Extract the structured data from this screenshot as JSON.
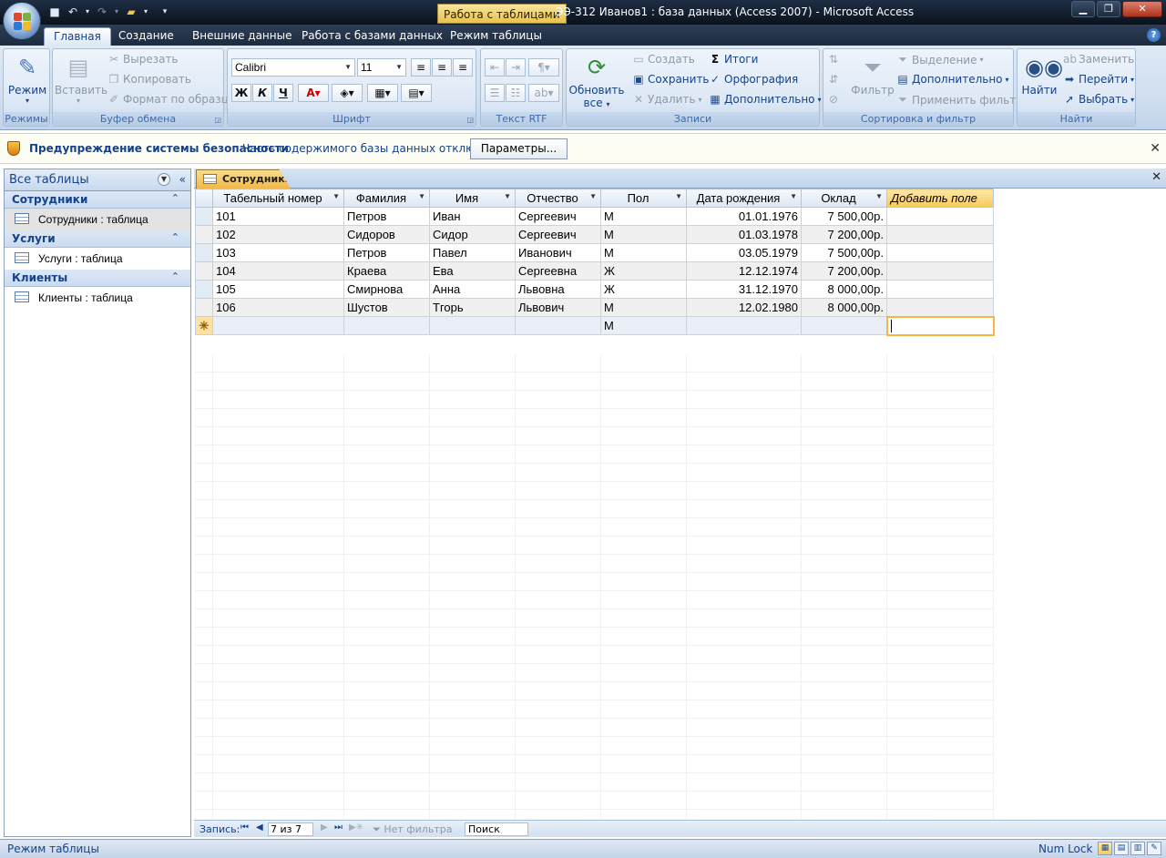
{
  "title_bar": {
    "context_tab": "Работа с таблицами",
    "title": "ЭЭ-312 Иванов1 : база данных (Access 2007)  -  Microsoft Access"
  },
  "tabs": [
    {
      "label": "Главная"
    },
    {
      "label": "Создание"
    },
    {
      "label": "Внешние данные"
    },
    {
      "label": "Работа с базами данных"
    },
    {
      "label": "Режим таблицы"
    }
  ],
  "ribbon": {
    "modes": {
      "label": "Режимы",
      "mode_button": "Режим"
    },
    "clipboard": {
      "label": "Буфер обмена",
      "paste": "Вставить",
      "cut": "Вырезать",
      "copy": "Копировать",
      "format_painter": "Формат по образцу"
    },
    "font": {
      "label": "Шрифт",
      "font_name": "Calibri",
      "font_size": "11",
      "bold": "Ж",
      "italic": "К",
      "underline": "Ч"
    },
    "rtf": {
      "label": "Текст RTF"
    },
    "records": {
      "label": "Записи",
      "refresh": "Обновить",
      "refresh2": "все",
      "new": "Создать",
      "save": "Сохранить",
      "delete": "Удалить",
      "totals": "Итоги",
      "spelling": "Орфография",
      "more": "Дополнительно"
    },
    "sort_filter": {
      "label": "Сортировка и фильтр",
      "filter": "Фильтр",
      "selection": "Выделение",
      "advanced": "Дополнительно",
      "apply_filter": "Применить фильтр"
    },
    "find": {
      "label": "Найти",
      "find": "Найти",
      "replace": "Заменить",
      "goto": "Перейти",
      "select": "Выбрать"
    }
  },
  "security_bar": {
    "title": "Предупреждение системы безопасности",
    "message": "Часть содержимого базы данных отключено",
    "button": "Параметры..."
  },
  "nav_pane": {
    "header": "Все таблицы",
    "groups": [
      {
        "name": "Сотрудники",
        "item": "Сотрудники : таблица"
      },
      {
        "name": "Услуги",
        "item": "Услуги : таблица"
      },
      {
        "name": "Клиенты",
        "item": "Клиенты : таблица"
      }
    ]
  },
  "document": {
    "tab": "Сотрудники",
    "columns": [
      "Табельный номер",
      "Фамилия",
      "Имя",
      "Отчество",
      "Пол",
      "Дата рождения",
      "Оклад",
      "Добавить поле"
    ],
    "rows": [
      [
        "101",
        "Петров",
        "Иван",
        "Сергеевич",
        "М",
        "01.01.1976",
        "7 500,00р."
      ],
      [
        "102",
        "Сидоров",
        "Сидор",
        "Сергеевич",
        "М",
        "01.03.1978",
        "7 200,00р."
      ],
      [
        "103",
        "Петров",
        "Павел",
        "Иванович",
        "М",
        "03.05.1979",
        "7 500,00р."
      ],
      [
        "104",
        "Краева",
        "Ева",
        "Сергеевна",
        "Ж",
        "12.12.1974",
        "7 200,00р."
      ],
      [
        "105",
        "Смирнова",
        "Анна",
        "Львовна",
        "Ж",
        "31.12.1970",
        "8 000,00р."
      ],
      [
        "106",
        "Шустов",
        "Тгорь",
        "Львович",
        "М",
        "12.02.1980",
        "8 000,00р."
      ]
    ],
    "new_row": {
      "marker": "✳",
      "gender_default": "М"
    }
  },
  "record_nav": {
    "label": "Запись:",
    "position": "7 из 7",
    "no_filter": "Нет фильтра",
    "search": "Поиск"
  },
  "status_bar": {
    "left": "Режим таблицы",
    "right": "Num Lock"
  }
}
